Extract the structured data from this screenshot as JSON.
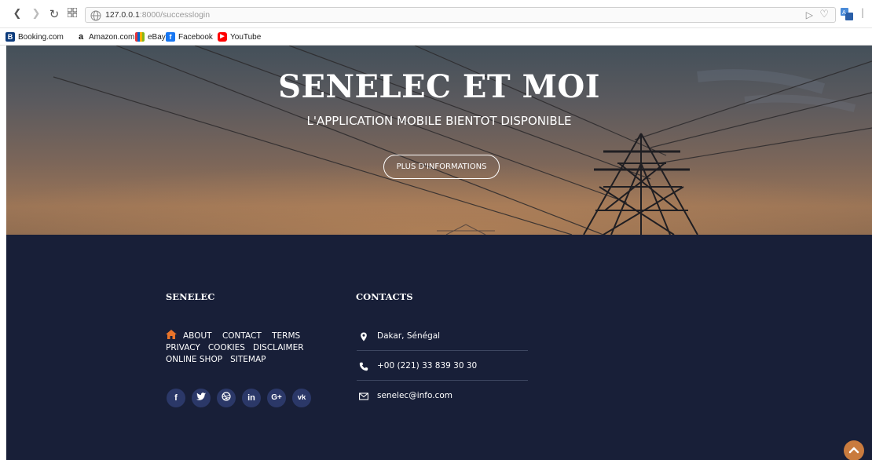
{
  "browser": {
    "url_host": "127.0.0.1",
    "url_path": ":8000/successlogin",
    "bookmarks": [
      {
        "label": "Booking.com",
        "icon": "booking-icon",
        "color": "#0c3b7c"
      },
      {
        "label": "Amazon.com",
        "icon": "amazon-icon",
        "color": "#111111"
      },
      {
        "label": "eBay",
        "icon": "ebay-icon",
        "color": "#e53238"
      },
      {
        "label": "Facebook",
        "icon": "facebook-icon",
        "color": "#1877f2"
      },
      {
        "label": "YouTube",
        "icon": "youtube-icon",
        "color": "#ff0000"
      }
    ]
  },
  "hero": {
    "title": "SENELEC ET MOI",
    "subtitle": "L'APPLICATION MOBILE BIENTOT DISPONIBLE",
    "button_label": "PLUS D'INFORMATIONS"
  },
  "footer": {
    "senelec_title": "SENELEC",
    "links": [
      "ABOUT",
      "CONTACT",
      "TERMS",
      "PRIVACY",
      "COOKIES",
      "DISCLAIMER",
      "ONLINE SHOP",
      "SITEMAP"
    ],
    "social_icons": [
      "facebook-icon",
      "twitter-icon",
      "dribbble-icon",
      "linkedin-icon",
      "google-plus-icon",
      "vk-icon"
    ],
    "contacts_title": "CONTACTS",
    "contacts": {
      "address": "Dakar, Sénégal",
      "phone": "+00 (221) 33 839 30 30",
      "email": "senelec@info.com"
    }
  },
  "colors": {
    "footer_bg": "#181f38",
    "accent": "#e8742a",
    "social_bg": "#2b3868",
    "scroll_top": "#c97b3e"
  }
}
